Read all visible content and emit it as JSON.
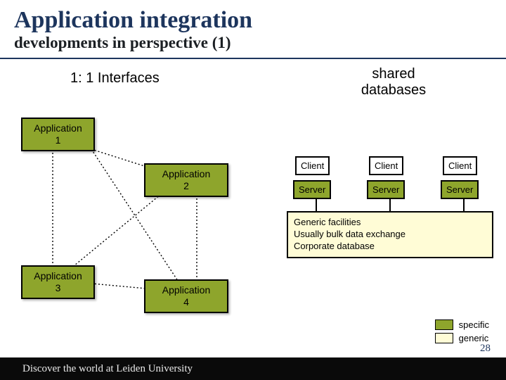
{
  "title": "Application integration",
  "subtitle": "developments in perspective (1)",
  "headings": {
    "left": "1: 1 Interfaces",
    "right": "shared databases"
  },
  "apps": {
    "app1": "Application\n1",
    "app2": "Application\n2",
    "app3": "Application\n3",
    "app4": "Application\n4"
  },
  "shared": {
    "client": "Client",
    "server": "Server",
    "generic_lines": [
      "Generic facilities",
      "Usually bulk data exchange",
      "Corporate database"
    ]
  },
  "legend": {
    "specific": "specific",
    "generic": "generic"
  },
  "footer": "Discover the world at Leiden University",
  "page": "28"
}
